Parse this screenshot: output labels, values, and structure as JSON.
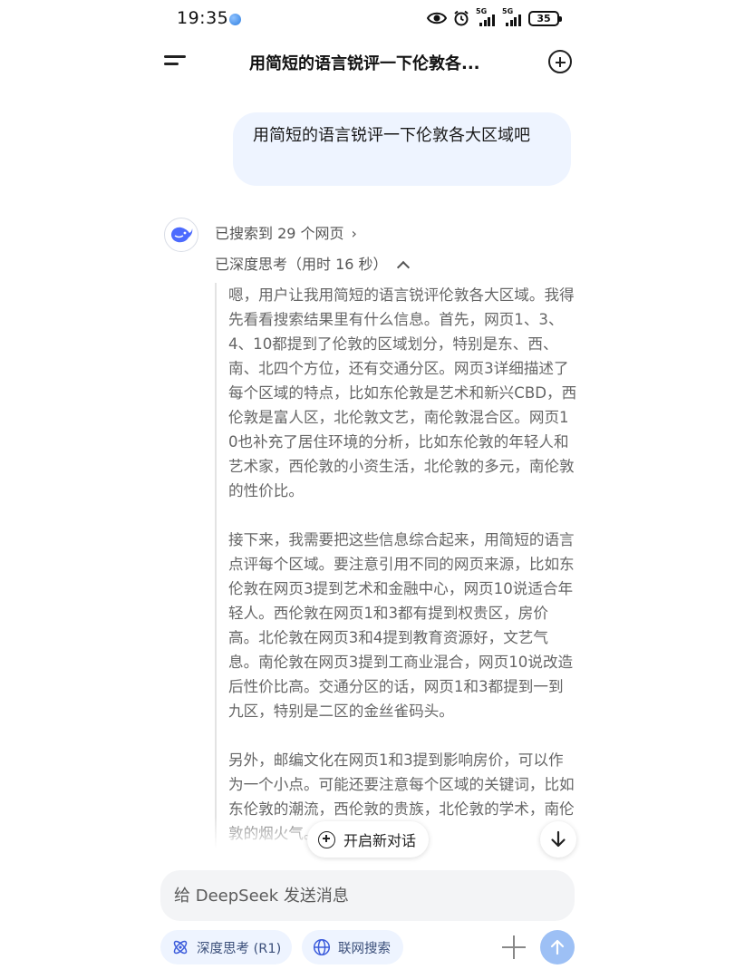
{
  "status_bar": {
    "time": "19:35",
    "signal_1_label": "5G",
    "signal_2_label": "5G",
    "battery": "35"
  },
  "header": {
    "title": "用简短的语言锐评一下伦敦各..."
  },
  "user_message": "用简短的语言锐评一下伦敦各大区域吧",
  "assistant": {
    "search_summary": "已搜索到 29 个网页",
    "thinking_summary": "已深度思考（用时 16 秒）",
    "thinking_paragraphs": [
      "嗯，用户让我用简短的语言锐评伦敦各大区域。我得先看看搜索结果里有什么信息。首先，网页1、3、4、10都提到了伦敦的区域划分，特别是东、西、南、北四个方位，还有交通分区。网页3详细描述了每个区域的特点，比如东伦敦是艺术和新兴CBD，西伦敦是富人区，北伦敦文艺，南伦敦混合区。网页10也补充了居住环境的分析，比如东伦敦的年轻人和艺术家，西伦敦的小资生活，北伦敦的多元，南伦敦的性价比。",
      "接下来，我需要把这些信息综合起来，用简短的语言点评每个区域。要注意引用不同的网页来源，比如东伦敦在网页3提到艺术和金融中心，网页10说适合年轻人。西伦敦在网页1和3都有提到权贵区，房价高。北伦敦在网页3和4提到教育资源好，文艺气息。南伦敦在网页3提到工商业混合，网页10说改造后性价比高。交通分区的话，网页1和3都提到一到九区，特别是二区的金丝雀码头。",
      "另外，邮编文化在网页1和3提到影响房价，可以作为一个小点。可能还要注意每个区域的关键词，比如东伦敦的潮流，西伦敦的贵族，北伦敦的学术，南伦敦的烟火气。"
    ]
  },
  "new_dialog_label": "开启新对话",
  "composer": {
    "placeholder": "给 DeepSeek 发送消息",
    "deep_think_label": "深度思考 (R1)",
    "web_search_label": "联网搜索"
  },
  "colors": {
    "accent": "#4d6bfe",
    "user_bubble": "#eef4ff",
    "chip_bg": "#eef4ff",
    "send_disabled": "#9dc0f5"
  },
  "icons": [
    "menu-icon",
    "new-chat-icon",
    "deepseek-whale-icon",
    "chevron-right-icon",
    "chevron-up-icon",
    "plus-circle-icon",
    "arrow-down-icon",
    "atom-icon",
    "globe-icon",
    "plus-icon",
    "arrow-up-icon"
  ]
}
